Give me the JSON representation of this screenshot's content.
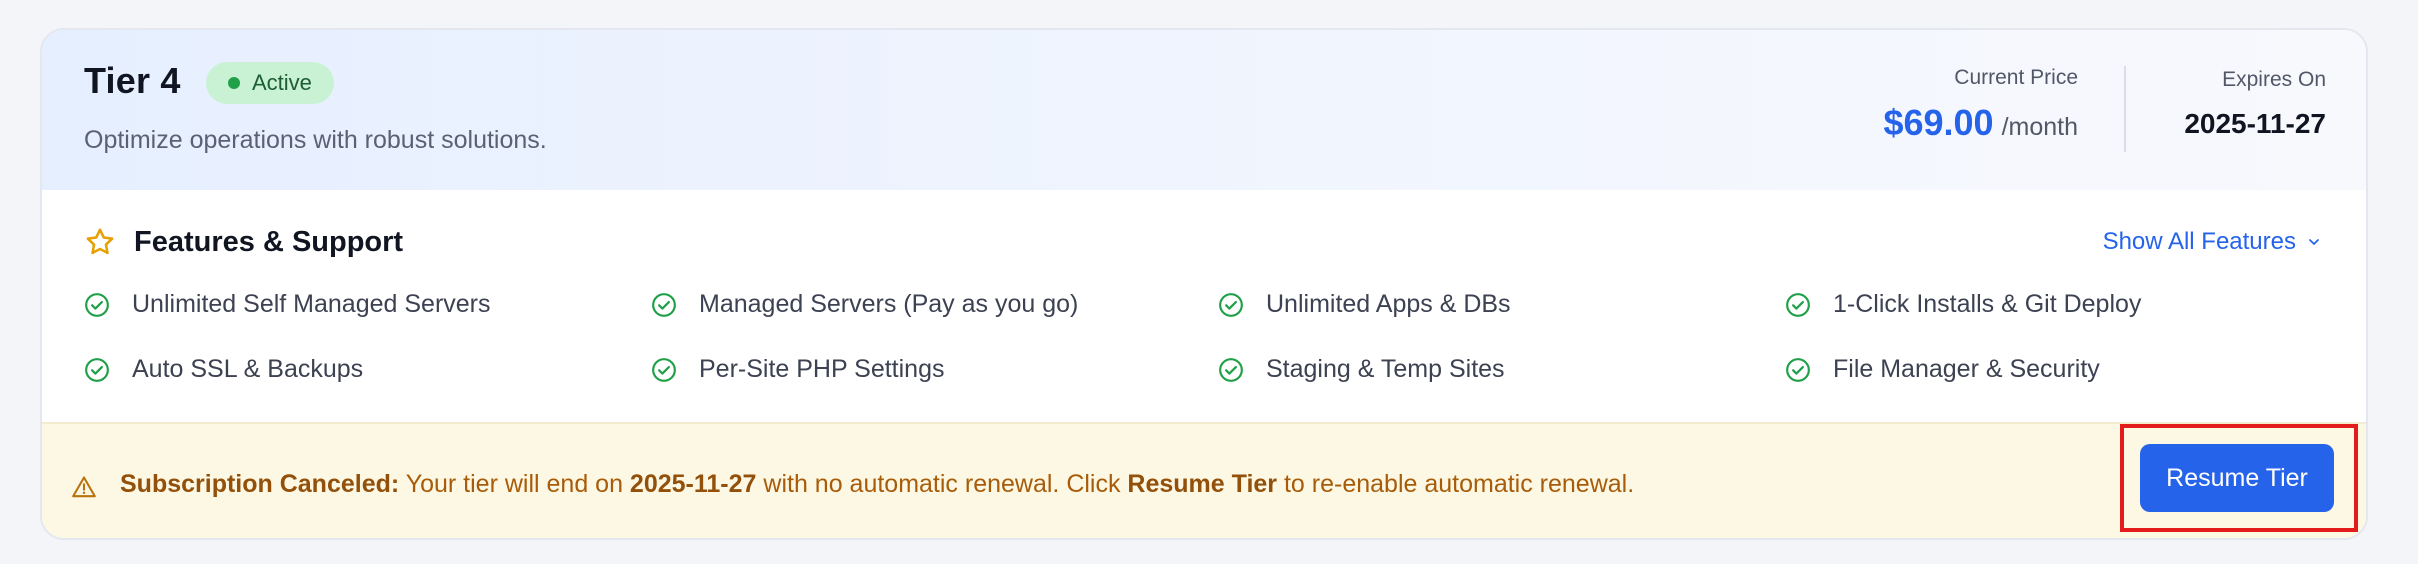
{
  "tier": {
    "name": "Tier 4",
    "status": "Active",
    "description": "Optimize operations with robust solutions.",
    "price_label": "Current Price",
    "price_amount": "$69.00",
    "price_unit": "/month",
    "expires_label": "Expires On",
    "expires_value": "2025-11-27"
  },
  "features": {
    "heading": "Features & Support",
    "show_all_label": "Show All Features",
    "items": [
      "Unlimited Self Managed Servers",
      "Managed Servers (Pay as you go)",
      "Unlimited Apps & DBs",
      "1-Click Installs & Git Deploy",
      "Auto SSL & Backups",
      "Per-Site PHP Settings",
      "Staging & Temp Sites",
      "File Manager & Security"
    ]
  },
  "banner": {
    "title": "Subscription Canceled:",
    "text_1": " Your tier will end on ",
    "date": "2025-11-27",
    "text_2": " with no automatic renewal. Click ",
    "action_ref": "Resume Tier",
    "text_3": " to re-enable automatic renewal.",
    "button_label": "Resume Tier"
  },
  "colors": {
    "accent": "#2563eb",
    "success": "#1fa049",
    "warning": "#a85c0a",
    "highlight_border": "#e41b1b"
  },
  "icons": {
    "features_heading": "star-icon",
    "feature_item": "check-circle-icon",
    "show_all": "chevron-down-icon",
    "banner": "warning-triangle-icon"
  }
}
